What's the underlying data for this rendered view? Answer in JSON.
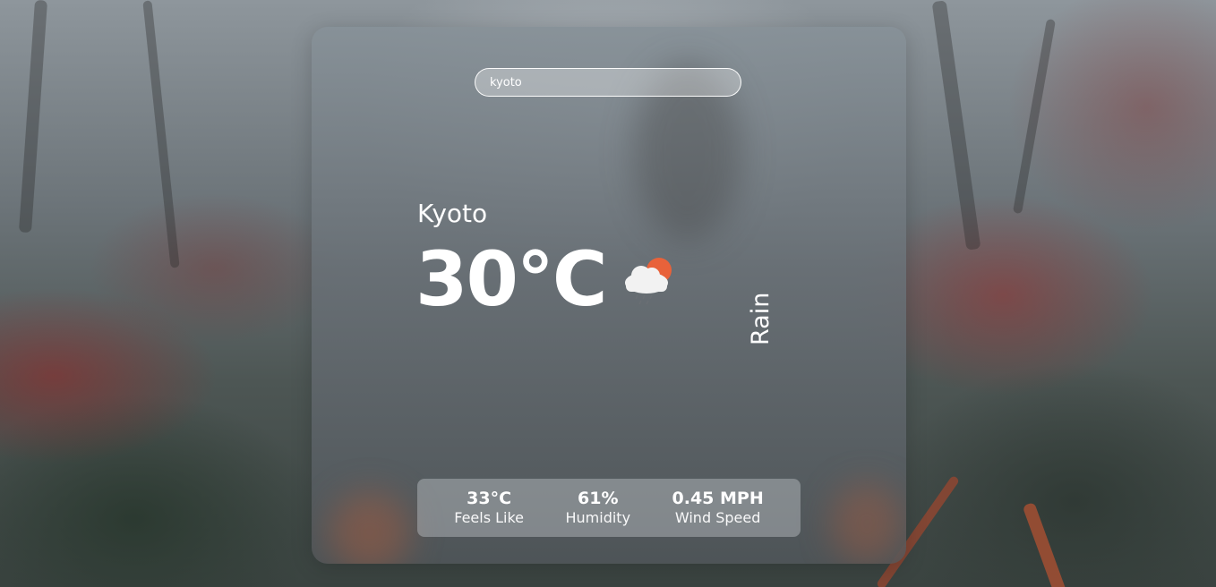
{
  "search": {
    "value": "kyoto",
    "placeholder": ""
  },
  "weather": {
    "city": "Kyoto",
    "temperature": "30°C",
    "condition": "Rain",
    "icon": "rain-cloud-sun-icon"
  },
  "stats": [
    {
      "value": "33°C",
      "label": "Feels Like"
    },
    {
      "value": "61%",
      "label": "Humidity"
    },
    {
      "value": "0.45 MPH",
      "label": "Wind Speed"
    }
  ],
  "colors": {
    "text": "#ffffff",
    "sun": "#e8623a",
    "cloud": "#f2f2f2",
    "rain": "#6a6f74"
  }
}
